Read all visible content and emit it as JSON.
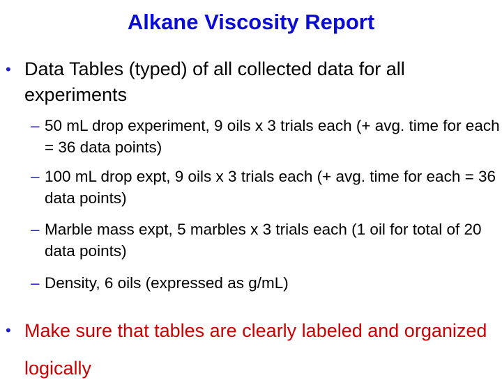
{
  "slide": {
    "title": "Alkane Viscosity Report",
    "bullets": [
      {
        "marker": "•",
        "text": "Data Tables (typed) of all collected data for all experiments",
        "sub_items": [
          {
            "marker": "–",
            "text": "50 mL drop experiment, 9 oils x 3 trials each (+ avg. time for each = 36 data points)"
          },
          {
            "marker": "–",
            "text": "100 mL drop expt, 9 oils x 3 trials each (+ avg. time for each = 36 data points)"
          },
          {
            "marker": "–",
            "text": "Marble mass expt, 5 marbles x 3 trials each (1 oil for total of 20 data points)"
          },
          {
            "marker": "–",
            "text": "Density, 6 oils (expressed as g/mL)"
          }
        ]
      },
      {
        "marker": "•",
        "text": "Make sure that tables are clearly labeled and organized logically"
      }
    ]
  },
  "colors": {
    "title": "#0b0bd6",
    "bullet_marker": "#1f1fd0",
    "body_text": "#000000",
    "highlight_text": "#cc0000"
  }
}
